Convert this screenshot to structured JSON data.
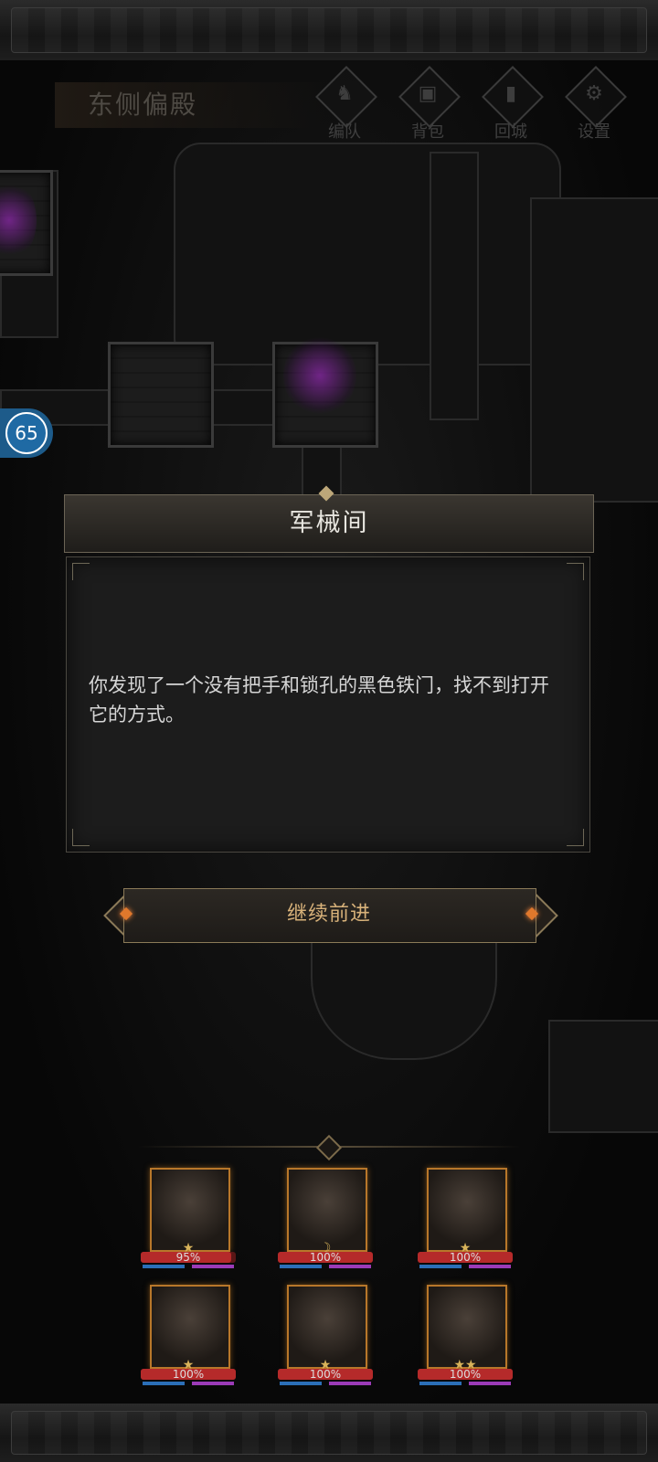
{
  "header": {
    "location": "东侧偏殿",
    "menu": [
      {
        "label": "编队",
        "icon": "helmet-icon"
      },
      {
        "label": "背包",
        "icon": "bag-icon"
      },
      {
        "label": "回城",
        "icon": "door-icon"
      },
      {
        "label": "设置",
        "icon": "gear-icon"
      }
    ]
  },
  "side_badge": {
    "value": "65"
  },
  "dialog": {
    "title": "军械间",
    "text": "你发现了一个没有把手和锁孔的黑色铁门，找不到打开它的方式。"
  },
  "continue_button": {
    "label": "继续前进"
  },
  "party": [
    {
      "hp": "95%",
      "hp_value": 0.95,
      "stars": "★"
    },
    {
      "hp": "100%",
      "hp_value": 1.0,
      "stars": "☽"
    },
    {
      "hp": "100%",
      "hp_value": 1.0,
      "stars": "★"
    },
    {
      "hp": "100%",
      "hp_value": 1.0,
      "stars": "★"
    },
    {
      "hp": "100%",
      "hp_value": 1.0,
      "stars": "★"
    },
    {
      "hp": "100%",
      "hp_value": 1.0,
      "stars": "★★"
    }
  ],
  "colors": {
    "accent_gold": "#d8b27a",
    "hp_red": "#b52a2a",
    "badge_blue": "#1d5b8a"
  }
}
